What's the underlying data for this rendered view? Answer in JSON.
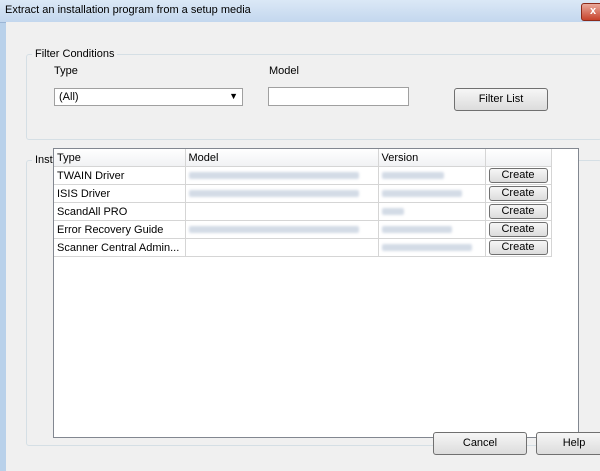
{
  "window": {
    "title": "Extract an installation program from a setup media",
    "close_label": "x"
  },
  "filter": {
    "legend": "Filter Conditions",
    "type_label": "Type",
    "type_value": "(All)",
    "model_label": "Model",
    "model_value": "",
    "filter_button": "Filter List"
  },
  "list": {
    "legend": "Installation Program List",
    "columns": [
      "Type",
      "Model",
      "Version",
      ""
    ],
    "rows": [
      {
        "type": "TWAIN Driver",
        "button": "Create"
      },
      {
        "type": "ISIS Driver",
        "button": "Create"
      },
      {
        "type": "ScandAll PRO",
        "button": "Create"
      },
      {
        "type": "Error Recovery Guide",
        "button": "Create"
      },
      {
        "type": "Scanner Central Admin...",
        "button": "Create"
      }
    ]
  },
  "footer": {
    "cancel_button": "Cancel",
    "help_button": "Help"
  },
  "colors": {
    "desktop": "#b9d1ea",
    "dialog": "#f0f0f0",
    "close": "#c7432b"
  }
}
